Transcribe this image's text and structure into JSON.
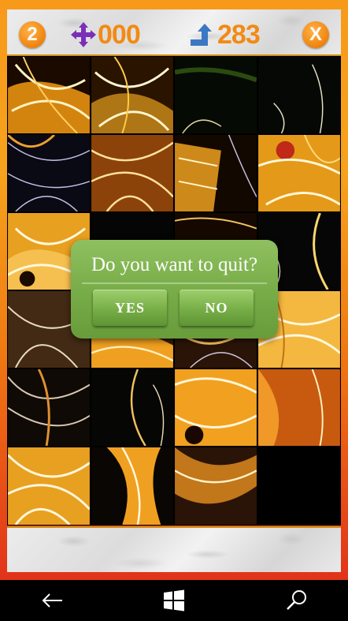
{
  "header": {
    "level": "2",
    "moves": "000",
    "time": "283",
    "close_label": "X"
  },
  "icons": {
    "moves_icon": "move-cross-icon",
    "time_icon": "turn-arrow-icon"
  },
  "dialog": {
    "question": "Do you want to quit?",
    "yes_label": "YES",
    "no_label": "NO"
  },
  "navbar": {
    "items": [
      "back-arrow-icon",
      "windows-start-icon",
      "search-icon"
    ]
  },
  "colors": {
    "accent_orange": "#f28a14",
    "move_icon_purple": "#7a2fb8",
    "time_icon_blue": "#3b78c4",
    "dialog_green": "#79ad49"
  }
}
